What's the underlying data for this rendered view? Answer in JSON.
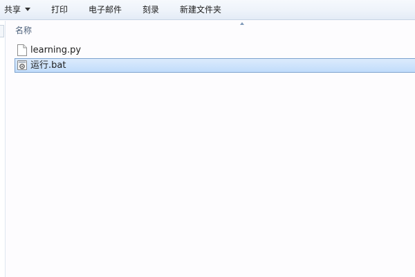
{
  "toolbar": {
    "share_label": "共享",
    "print_label": "打印",
    "email_label": "电子邮件",
    "burn_label": "刻录",
    "new_folder_label": "新建文件夹"
  },
  "columns": {
    "name_header": "名称"
  },
  "files": [
    {
      "name": "learning.py",
      "icon": "document-icon",
      "selected": false
    },
    {
      "name": "运行.bat",
      "icon": "batch-file-icon",
      "selected": true
    }
  ],
  "colors": {
    "selection_fill": "#cce4fc",
    "selection_border": "#7da2ce",
    "toolbar_bg": "#eef3fa"
  }
}
